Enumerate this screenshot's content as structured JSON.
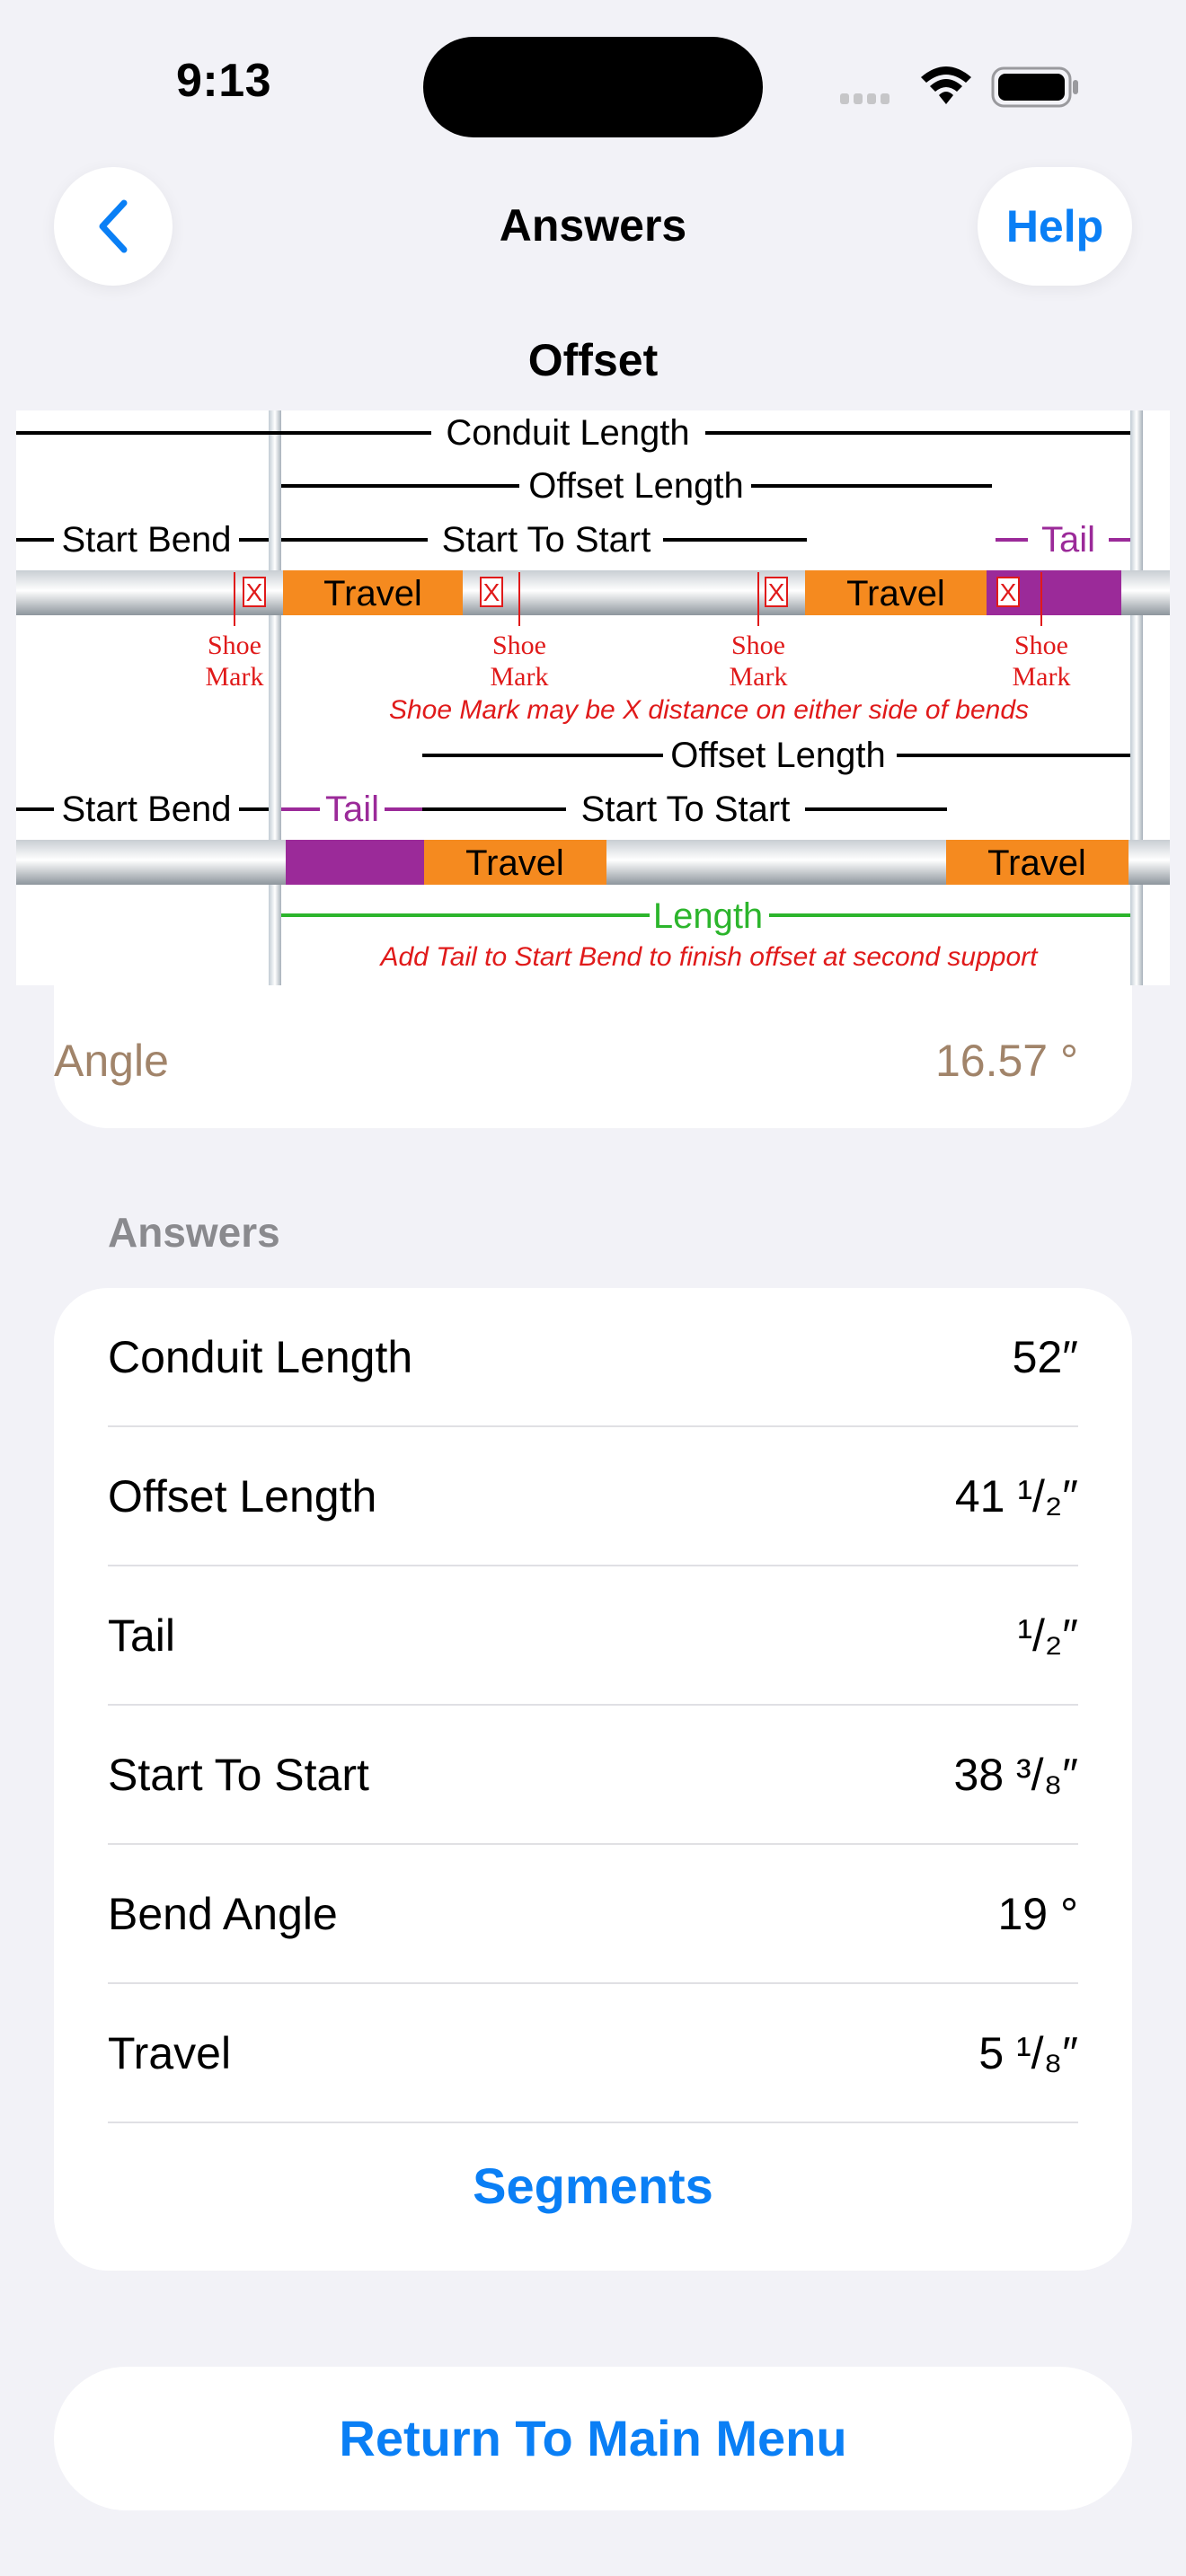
{
  "status_bar": {
    "time": "9:13",
    "icons": [
      "signal-icon",
      "wifi-icon",
      "battery-icon"
    ]
  },
  "nav": {
    "back_icon": "chevron-left-icon",
    "title": "Answers",
    "help_label": "Help"
  },
  "diagram": {
    "title": "Offset",
    "labels": {
      "conduit_length": "Conduit Length",
      "offset_length": "Offset Length",
      "start_bend": "Start Bend",
      "start_to_start": "Start To Start",
      "tail": "Tail",
      "travel": "Travel",
      "x": "X",
      "shoe": "Shoe",
      "mark": "Mark",
      "shoe_note": "Shoe Mark may be X distance on either side of bends",
      "length": "Length",
      "tail_note": "Add Tail to Start Bend to finish offset at second support"
    },
    "colors": {
      "travel": "#f58a1f",
      "tail": "#9b2a99",
      "length": "#2cb52c",
      "note": "#e01a1a"
    }
  },
  "angle": {
    "label": "Angle",
    "value": "16.57 °"
  },
  "answers": {
    "header": "Answers",
    "rows": [
      {
        "label": "Conduit Length",
        "value": "52″"
      },
      {
        "label": "Offset Length",
        "value": "41 ¹/₂″"
      },
      {
        "label": "Tail",
        "value": "¹/₂″"
      },
      {
        "label": "Start To Start",
        "value": "38 ³/₈″"
      },
      {
        "label": "Bend Angle",
        "value": "19 °"
      },
      {
        "label": "Travel",
        "value": "5 ¹/₈″"
      }
    ],
    "segments_label": "Segments"
  },
  "main_menu_label": "Return To Main Menu"
}
